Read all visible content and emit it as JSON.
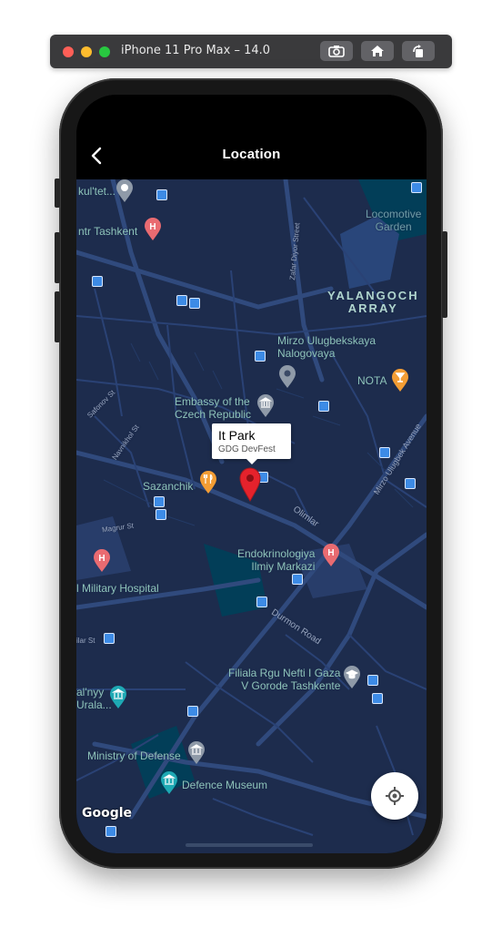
{
  "simulator": {
    "title": "iPhone 11 Pro Max – 14.0",
    "buttons": [
      "screenshot-icon",
      "home-icon",
      "rotate-icon"
    ]
  },
  "appbar": {
    "title": "Location",
    "back_icon": "chevron-left-icon"
  },
  "map": {
    "labels": {
      "tashkent": "ntr Tashkent",
      "kultet": "kul'tet...",
      "locomotive": "Locomotive\nGarden",
      "yalangoch": "YALANGOCH\nARRAY",
      "mirzo": "Mirzo Ulugbekskaya\nNalogovaya",
      "nota": "NOTA",
      "embassy": "Embassy of the\nCzech Republic",
      "sazanchik": "Sazanchik",
      "endokrinologiya": "Endokrinologiya\nIlmiy Markazi",
      "military_hospital": "l Military Hospital",
      "filiala": "Filiala Rgu Nefti I Gaza\nV Gorode Tashkente",
      "ministry": "Ministry of Defense",
      "defence_museum": "Defence Museum",
      "alnyy": "al'nyy\nUrala...",
      "olimlar": "Olimlar",
      "durmon": "Durmon Road",
      "mirzo_ave": "Mirzo Ulugbek Avenue",
      "magrur": "Magrur St",
      "zafar": "Zafar Diyor Street",
      "saforov": "Safonov St",
      "navnikhol": "Navnikhol St",
      "ular": "ilar St"
    },
    "marker": {
      "title": "It Park",
      "snippet": "GDG DevFest",
      "color": "#e5222c"
    },
    "attribution": "Google",
    "locate_icon": "my-location-icon",
    "colors": {
      "background": "#1d2c4d",
      "road": "#304a7d",
      "highway": "#2c6675",
      "label": "#8ec3b9",
      "water": "#0e1626",
      "park": "#023e58"
    }
  }
}
